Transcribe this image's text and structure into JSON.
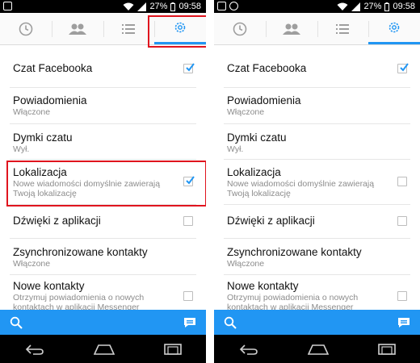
{
  "status": {
    "battery": "27%",
    "time": "09:58"
  },
  "tabs": [
    {
      "icon": "clock-icon"
    },
    {
      "icon": "people-icon"
    },
    {
      "icon": "list-icon"
    },
    {
      "icon": "gear-icon"
    }
  ],
  "colors": {
    "accent": "#2196f3",
    "highlight": "#e0141e",
    "checkbox_checked": "#2196f3"
  },
  "settings_left": [
    {
      "title": "Czat Facebooka",
      "subtitle": "",
      "checkbox": true
    },
    {
      "title": "Powiadomienia",
      "subtitle": "Włączone",
      "checkbox": null
    },
    {
      "title": "Dymki czatu",
      "subtitle": "Wył.",
      "checkbox": null
    },
    {
      "title": "Lokalizacja",
      "subtitle": "Nowe wiadomości domyślnie zawierają Twoją lokalizację",
      "checkbox": true
    },
    {
      "title": "Dźwięki z aplikacji",
      "subtitle": "",
      "checkbox": false
    },
    {
      "title": "Zsynchronizowane kontakty",
      "subtitle": "Włączone",
      "checkbox": null
    },
    {
      "title": "Nowe kontakty",
      "subtitle": "Otrzymuj powiadomienia o nowych kontaktach w aplikacji Messenger",
      "checkbox": false
    }
  ],
  "settings_right": [
    {
      "title": "Czat Facebooka",
      "subtitle": "",
      "checkbox": true
    },
    {
      "title": "Powiadomienia",
      "subtitle": "Włączone",
      "checkbox": null
    },
    {
      "title": "Dymki czatu",
      "subtitle": "Wył.",
      "checkbox": null
    },
    {
      "title": "Lokalizacja",
      "subtitle": "Nowe wiadomości domyślnie zawierają Twoją lokalizację",
      "checkbox": false
    },
    {
      "title": "Dźwięki z aplikacji",
      "subtitle": "",
      "checkbox": false
    },
    {
      "title": "Zsynchronizowane kontakty",
      "subtitle": "Włączone",
      "checkbox": null
    },
    {
      "title": "Nowe kontakty",
      "subtitle": "Otrzymuj powiadomienia o nowych kontaktach w aplikacji Messenger",
      "checkbox": false
    }
  ],
  "bottom_bar": {
    "left_icon": "search-icon",
    "right_icon": "compose-icon"
  },
  "nav": [
    {
      "icon": "back-icon"
    },
    {
      "icon": "home-icon"
    },
    {
      "icon": "recents-icon"
    }
  ]
}
